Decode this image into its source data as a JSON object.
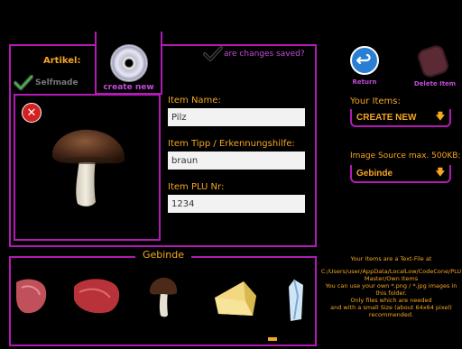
{
  "header": {
    "changes_saved_label": "are changes saved?"
  },
  "article": {
    "title": "Artikel:",
    "selfmade_label": "Selfmade",
    "create_new_label": "create new"
  },
  "form": {
    "item_name_label": "Item Name:",
    "item_name_value": "Pilz",
    "item_tip_label": "Item Tipp / Erkennungshilfe:",
    "item_tip_value": "braun",
    "item_plu_label": "Item PLU Nr:",
    "item_plu_value": "1234"
  },
  "right_panel": {
    "return_label": "Return",
    "delete_label": "Delete Item",
    "your_items_label": "Your Items:",
    "your_items_selected": "CREATE NEW",
    "image_source_label": "Image Source max. 500KB:",
    "image_source_selected": "Gebinde"
  },
  "gallery": {
    "title": "Gebinde"
  },
  "info": {
    "line1": "Your Items are a Text-File at",
    "line2": "C:/Users/user/AppData/LocalLow/CodeCone/PLU Master/Own Items",
    "line3": "You can use your own *.png / *.jpg images in this folder.",
    "line4": "Only files which are needed",
    "line5": "and with a small Size (about 64x64 pixel)",
    "line6": "recommended."
  },
  "colors": {
    "accent": "#f5a623",
    "border": "#b31ab3",
    "return_button": "#2a7fd4",
    "delete_button": "#5a2a35"
  }
}
